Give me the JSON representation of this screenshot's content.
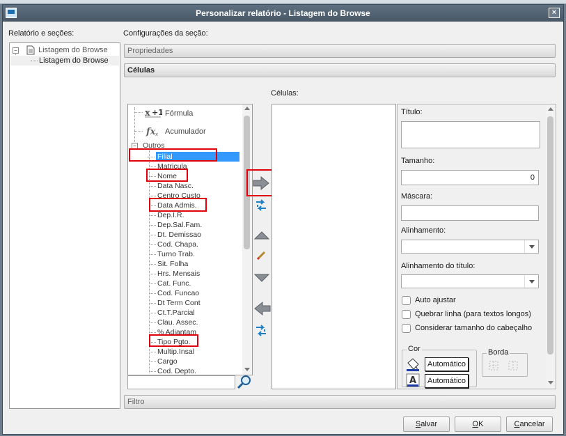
{
  "window": {
    "title": "Personalizar relatório - Listagem do Browse",
    "close_glyph": "×"
  },
  "left": {
    "label": "Relatório e seções:",
    "tree": {
      "root": "Listagem do Browse",
      "child": "Listagem do Browse"
    }
  },
  "config": {
    "label": "Configurações da seção:",
    "propriedades": "Propriedades",
    "celulas_bar": "Células",
    "filtro": "Filtro"
  },
  "fields": {
    "formula": "Fórmula",
    "acumulador": "Acumulador",
    "outros": "Outros",
    "items": [
      "Filial",
      "Matricula",
      "Nome",
      "Data Nasc.",
      "Centro Custo",
      "Data Admis.",
      "Dep.I.R.",
      "Dep.Sal.Fam.",
      "Dt. Demissao",
      "Cod. Chapa.",
      "Turno Trab.",
      "Sit. Folha",
      "Hrs. Mensais",
      "Cat. Func.",
      "Cod. Funcao",
      "Dt Term Cont",
      "Ct.T.Parcial",
      "Clau. Assec.",
      "% Adiantam",
      "Tipo Pgto.",
      "Multip.Insal",
      "Cargo",
      "Cod. Depto."
    ],
    "selected_index": 0,
    "highlighted": [
      "Filial",
      "Nome",
      "Data Admis.",
      "Tipo Pgto."
    ],
    "search_value": ""
  },
  "cells": {
    "label": "Células:"
  },
  "props": {
    "titulo_label": "Título:",
    "titulo_value": "",
    "tamanho_label": "Tamanho:",
    "tamanho_value": "0",
    "mascara_label": "Máscara:",
    "mascara_value": "",
    "alinhamento_label": "Alinhamento:",
    "alinhamento_value": "",
    "alinhamento_titulo_label": "Alinhamento do título:",
    "alinhamento_titulo_value": "",
    "auto_ajustar": "Auto ajustar",
    "quebrar_linha": "Quebrar linha (para textos longos)",
    "considerar": "Considerar tamanho do cabeçalho",
    "cor_label": "Cor",
    "borda_label": "Borda",
    "auto_fill": "Automático",
    "auto_font": "Automático"
  },
  "buttons": {
    "salvar_u": "S",
    "salvar_rest": "alvar",
    "ok_u": "O",
    "ok_rest": "K",
    "cancelar_u": "C",
    "cancelar_rest": "ancelar"
  },
  "icons": [
    "formula-icon",
    "accumulator-icon",
    "add-arrow-icon",
    "move-all-icon",
    "move-up-icon",
    "edit-icon",
    "move-down-icon",
    "remove-arrow-icon",
    "swap-icon",
    "search-icon",
    "fill-color-icon",
    "font-color-icon",
    "border-icon"
  ],
  "colors": {
    "highlight_red": "#e0000b",
    "selection": "#3399ff",
    "titlebar": "#4f5f6f"
  }
}
